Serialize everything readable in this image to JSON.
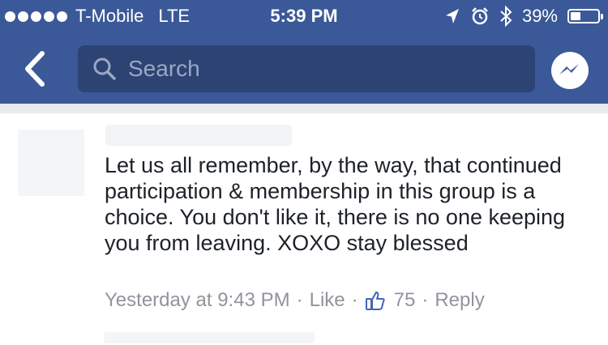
{
  "status_bar": {
    "carrier": "T-Mobile",
    "network": "LTE",
    "time": "5:39 PM",
    "battery": "39%",
    "battery_level": 0.39
  },
  "nav": {
    "search_placeholder": "Search",
    "accent_color": "#3b5998"
  },
  "comment": {
    "text": "Let us all remember, by the way, that continued participation & membership in this group is a choice. You don't like it, there is no one keeping you from leaving. XOXO stay blessed",
    "timestamp": "Yesterday at 9:43 PM",
    "like_label": "Like",
    "like_count": "75",
    "reply_label": "Reply"
  },
  "icons": [
    "signal-dots-icon",
    "location-arrow-icon",
    "alarm-icon",
    "bluetooth-icon",
    "battery-icon",
    "back-chevron-icon",
    "search-icon",
    "messenger-icon",
    "thumbs-up-icon"
  ]
}
